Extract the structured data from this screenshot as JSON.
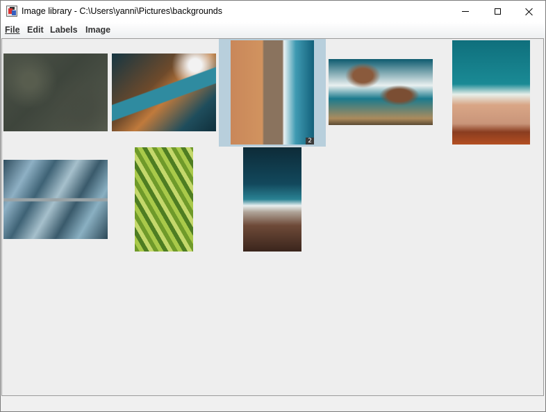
{
  "window": {
    "title": "Image library - C:\\Users\\yanni\\Pictures\\backgrounds",
    "icon": "java-app-icon",
    "controls": [
      "minimize-icon",
      "maximize-icon",
      "close-icon"
    ]
  },
  "menubar": {
    "items": [
      {
        "label": "File"
      },
      {
        "label": "Edit"
      },
      {
        "label": "Labels"
      },
      {
        "label": "Image"
      }
    ]
  },
  "gallery": {
    "selected_index": 2,
    "selection_color": "#b8cfdc",
    "thumbnails": [
      {
        "id": "road-aerial",
        "badge": ""
      },
      {
        "id": "sea-pool",
        "badge": ""
      },
      {
        "id": "beach-wall",
        "badge": "2"
      },
      {
        "id": "sea-rocks",
        "badge": ""
      },
      {
        "id": "shore-beach",
        "badge": ""
      },
      {
        "id": "river-delta",
        "badge": ""
      },
      {
        "id": "green-fields",
        "badge": ""
      },
      {
        "id": "waves-vertical",
        "badge": ""
      }
    ]
  }
}
